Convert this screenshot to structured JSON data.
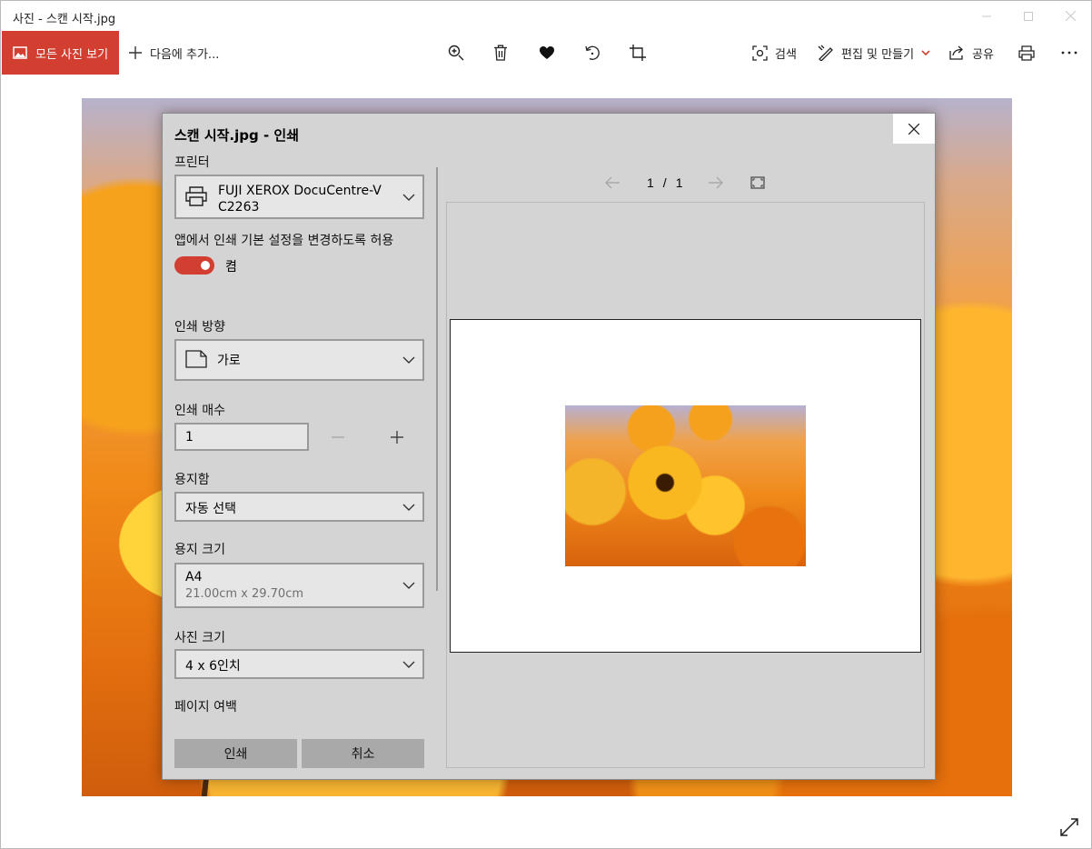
{
  "window": {
    "title": "사진 - 스캔 시작.jpg"
  },
  "toolbar": {
    "all_photos": "모든 사진 보기",
    "add_to": "다음에 추가...",
    "search": "검색",
    "edit_create": "편집 및 만들기",
    "share": "공유"
  },
  "dialog": {
    "title": "스캔 시작.jpg - 인쇄",
    "printer_label": "프린터",
    "printer_value_line1": "FUJI XEROX DocuCentre-V",
    "printer_value_line2": "C2263",
    "allow_label": "앱에서 인쇄 기본 설정을 변경하도록 허용",
    "toggle_state": "켬",
    "orientation_label": "인쇄 방향",
    "orientation_value": "가로",
    "copies_label": "인쇄 매수",
    "copies_value": "1",
    "tray_label": "용지함",
    "tray_value": "자동 선택",
    "paper_size_label": "용지 크기",
    "paper_size_value": "A4",
    "paper_size_detail": "21.00cm x 29.70cm",
    "photo_size_label": "사진 크기",
    "photo_size_value": "4 x 6인치",
    "margins_label": "페이지 여백",
    "print_button": "인쇄",
    "cancel_button": "취소",
    "page_current": "1",
    "page_sep": "/",
    "page_total": "1"
  },
  "colors": {
    "accent": "#d23f31",
    "dialog_bg": "#d4d4d4"
  }
}
